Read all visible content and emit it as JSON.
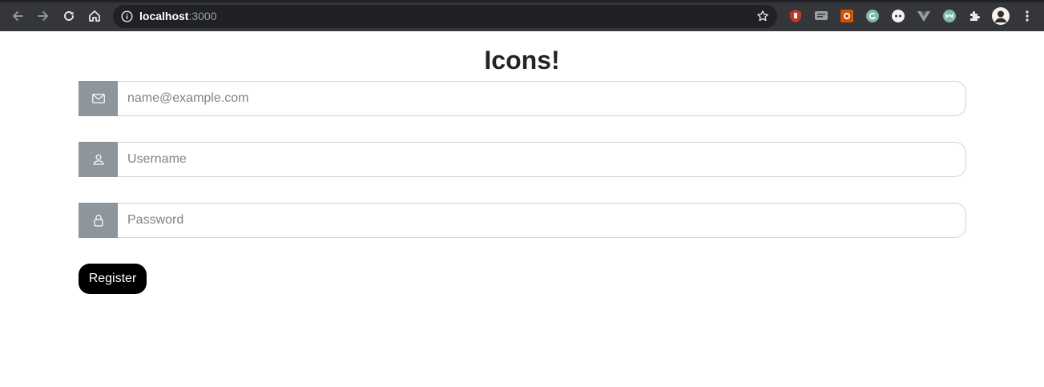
{
  "browser": {
    "url_host": "localhost",
    "url_port": ":3000",
    "extensions": [
      "ublock-icon",
      "translate-icon",
      "clipper-icon",
      "grammarly-icon",
      "extension-circle-icon",
      "vue-devtools-icon",
      "extension-m-icon",
      "puzzle-icon",
      "profile-avatar"
    ]
  },
  "page": {
    "title": "Icons!"
  },
  "form": {
    "email_placeholder": "name@example.com",
    "username_placeholder": "Username",
    "password_placeholder": "Password",
    "register_label": "Register"
  },
  "colors": {
    "addon_bg": "#8e969b",
    "button_bg": "#000000",
    "chrome_bg": "#35363a"
  }
}
